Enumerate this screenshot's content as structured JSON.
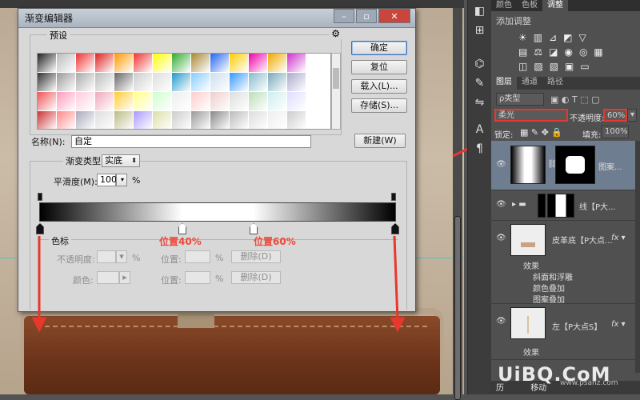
{
  "dialog": {
    "title": "渐变编辑器",
    "presets_label": "预设",
    "buttons": {
      "ok": "确定",
      "reset": "复位",
      "load": "载入(L)...",
      "save": "存储(S)...",
      "new": "新建(W)"
    },
    "name_label": "名称(N):",
    "name_value": "自定",
    "gradient_type_label": "渐变类型:",
    "gradient_type_value": "实底",
    "smoothness_label": "平滑度(M):",
    "smoothness_value": "100",
    "percent": "%",
    "color_stops_label": "色标",
    "opacity_label": "不透明度:",
    "color_label": "颜色:",
    "location_label": "位置:",
    "delete_label": "删除(D)",
    "annotations": {
      "pos40": "位置40%",
      "pos60": "位置60%"
    },
    "swatch_colors": [
      [
        "#222",
        "#bbb",
        "#e33",
        "#d22",
        "#f90",
        "#e33",
        "#ff0",
        "#3a3",
        "#a83",
        "#26e",
        "#fc0",
        "#e0a",
        "#ea0",
        "#c3c"
      ],
      [
        "#333",
        "#999",
        "#aaa",
        "#bbb",
        "#666",
        "#ccc",
        "#ddd",
        "#29c",
        "#8cf",
        "#cde",
        "#39f",
        "#8bc",
        "#7ab",
        "#aac"
      ],
      [
        "#e55",
        "#f9b",
        "#fcd",
        "#eab",
        "#fc3",
        "#ff8",
        "#cfc",
        "#eee",
        "#fcc",
        "#ecc",
        "#ddd",
        "#bdb",
        "#cee",
        "#ddf"
      ],
      [
        "#c33",
        "#f88",
        "#aab",
        "#ddd",
        "#bb8",
        "#a9f",
        "#dda",
        "#ccc",
        "#999",
        "#888",
        "#bbb",
        "#ddd",
        "#eee",
        "#ccc"
      ]
    ]
  },
  "panel": {
    "tabs_top": [
      "颜色",
      "色板",
      "调整"
    ],
    "adjust_title": "添加调整",
    "layers_tabs": [
      "图层",
      "通道",
      "路径"
    ],
    "filter_value": "ρ类型",
    "blend_mode": "柔光",
    "opacity_label": "不透明度:",
    "opacity_value": "60%",
    "lock_label": "锁定:",
    "fill_label": "填充:",
    "fill_value": "100%",
    "layers": [
      {
        "name": "图案...",
        "effects": []
      },
      {
        "name": "线【P大...",
        "effects": []
      },
      {
        "name": "皮革底【P大点...",
        "effects": [
          "效果",
          "斜面和浮雕",
          "颜色叠加",
          "图案叠加"
        ]
      },
      {
        "name": "左【P大点S】",
        "effects": [
          "效果"
        ]
      }
    ],
    "bottom_tab": "历",
    "bottom_item": "移动"
  },
  "watermark": {
    "main": "UiBQ.CoM",
    "sub": "www.psahz.com"
  }
}
